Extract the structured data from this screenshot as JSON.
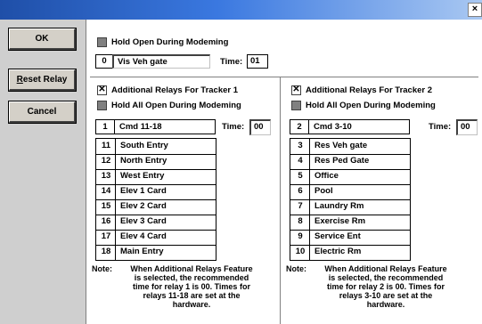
{
  "titlebar": {
    "close_glyph": "×"
  },
  "buttons": {
    "ok": "OK",
    "reset_relay_pre": "",
    "reset_relay_ul": "R",
    "reset_relay_post": "eset Relay",
    "cancel": "Cancel"
  },
  "top": {
    "hold_open_label": "Hold Open During Modeming",
    "relay_number": "0",
    "relay_name": "Vis Veh gate",
    "time_label": "Time:",
    "time_value": "01"
  },
  "tracker1": {
    "additional_label": "Additional Relays For Tracker 1",
    "hold_all_label": "Hold All Open During Modeming",
    "relay_number": "1",
    "relay_name": "Cmd 11-18",
    "time_label": "Time:",
    "time_value": "00",
    "relays": [
      {
        "num": "11",
        "name": "South Entry"
      },
      {
        "num": "12",
        "name": "North Entry"
      },
      {
        "num": "13",
        "name": "West Entry"
      },
      {
        "num": "14",
        "name": "Elev 1 Card"
      },
      {
        "num": "15",
        "name": "Elev 2 Card"
      },
      {
        "num": "16",
        "name": "Elev 3 Card"
      },
      {
        "num": "17",
        "name": "Elev 4 Card"
      },
      {
        "num": "18",
        "name": "Main Entry"
      }
    ],
    "note_head": "Note:",
    "note_lines": [
      "When Additional Relays Feature",
      "is selected, the recommended",
      "time for relay 1 is 00. Times for",
      "relays 11-18 are set at the",
      "hardware."
    ]
  },
  "tracker2": {
    "additional_label": "Additional Relays For Tracker 2",
    "hold_all_label": "Hold All Open During Modeming",
    "relay_number": "2",
    "relay_name": "Cmd 3-10",
    "time_label": "Time:",
    "time_value": "00",
    "relays": [
      {
        "num": "3",
        "name": "Res Veh gate"
      },
      {
        "num": "4",
        "name": "Res Ped Gate"
      },
      {
        "num": "5",
        "name": "Office"
      },
      {
        "num": "6",
        "name": "Pool"
      },
      {
        "num": "7",
        "name": "Laundry Rm"
      },
      {
        "num": "8",
        "name": "Exercise Rm"
      },
      {
        "num": "9",
        "name": "Service Ent"
      },
      {
        "num": "10",
        "name": "Electric Rm"
      }
    ],
    "note_head": "Note:",
    "note_lines": [
      "When Additional Relays Feature",
      "is selected, the recommended",
      "time for relay 2 is 00. Times for",
      "relays 3-10 are set at the",
      "hardware."
    ]
  },
  "checkbox_checked_glyph": "✕"
}
